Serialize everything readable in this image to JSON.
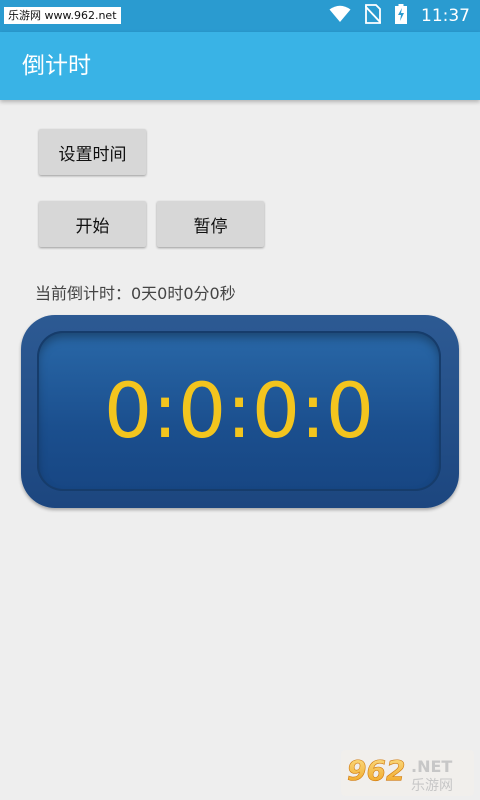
{
  "status_bar": {
    "watermark": "乐游网 www.962.net",
    "time": "11:37"
  },
  "app_bar": {
    "title": "倒计时"
  },
  "buttons": {
    "set_time": "设置时间",
    "start": "开始",
    "pause": "暂停"
  },
  "countdown": {
    "label": "当前倒计时：0天0时0分0秒",
    "display": "0:0:0:0"
  },
  "watermark_bottom": {
    "brand": "962.NET",
    "name": "乐游网"
  },
  "colors": {
    "status_bar": "#2a9bd0",
    "app_bar": "#39b3e6",
    "clock_digits": "#f3c51e",
    "clock_panel": "#1f4c86"
  }
}
